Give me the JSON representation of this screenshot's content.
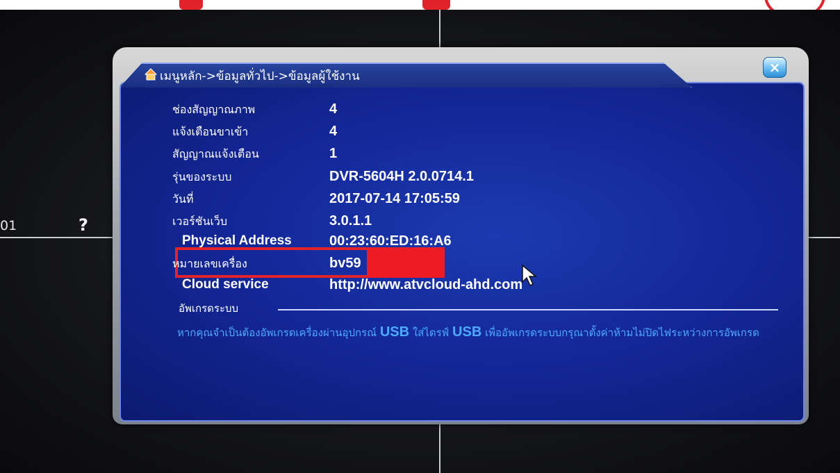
{
  "screen": {
    "channel_label": "01",
    "help_glyph": "?"
  },
  "dialog": {
    "title": "เมนูหลัก->ข้อมูลทั่วไป->ข้อมูลผู้ใช้งาน",
    "close_glyph": "×",
    "rows": [
      {
        "label": "ช่องสัญญาณภาพ",
        "value": "4"
      },
      {
        "label": "แจ้งเตือนขาเข้า",
        "value": "4"
      },
      {
        "label": "สัญญาณแจ้งเตือน",
        "value": "1"
      },
      {
        "label": "รุ่นของระบบ",
        "value": "DVR-5604H  2.0.0714.1"
      },
      {
        "label": "วันที่",
        "value": "2017-07-14 17:05:59"
      },
      {
        "label": "เวอร์ชันเว็บ",
        "value": "3.0.1.1"
      },
      {
        "label": "Physical Address",
        "value": "00:23:60:ED:16:A6"
      },
      {
        "label": "หมายเลขเครื่อง",
        "value": "bv59"
      },
      {
        "label": "Cloud service",
        "value": "http://www.atvcloud-ahd.com"
      }
    ],
    "upgrade_section": {
      "title": "อัพเกรดระบบ",
      "msg_part1": "หากคุณจำเป็นต้องอัพเกรดเครื่องผ่านอุปกรณ์ ",
      "msg_usb1": "USB",
      "msg_part2": " ใส่ไดรฟ์ ",
      "msg_usb2": "USB",
      "msg_part3": " เพื่ออัพเกรดระบบกรุณาตั้งค่าห้ามไม่ปิดไฟระหว่างการอัพเกรด"
    }
  },
  "colors": {
    "panel_blue": "#14289a",
    "accent_red": "#e3232b",
    "info_text_blue": "#4fa9ff"
  },
  "icons": {
    "title": "home-icon",
    "close": "close-icon",
    "cursor": "mouse-pointer-icon",
    "help": "help-icon"
  }
}
